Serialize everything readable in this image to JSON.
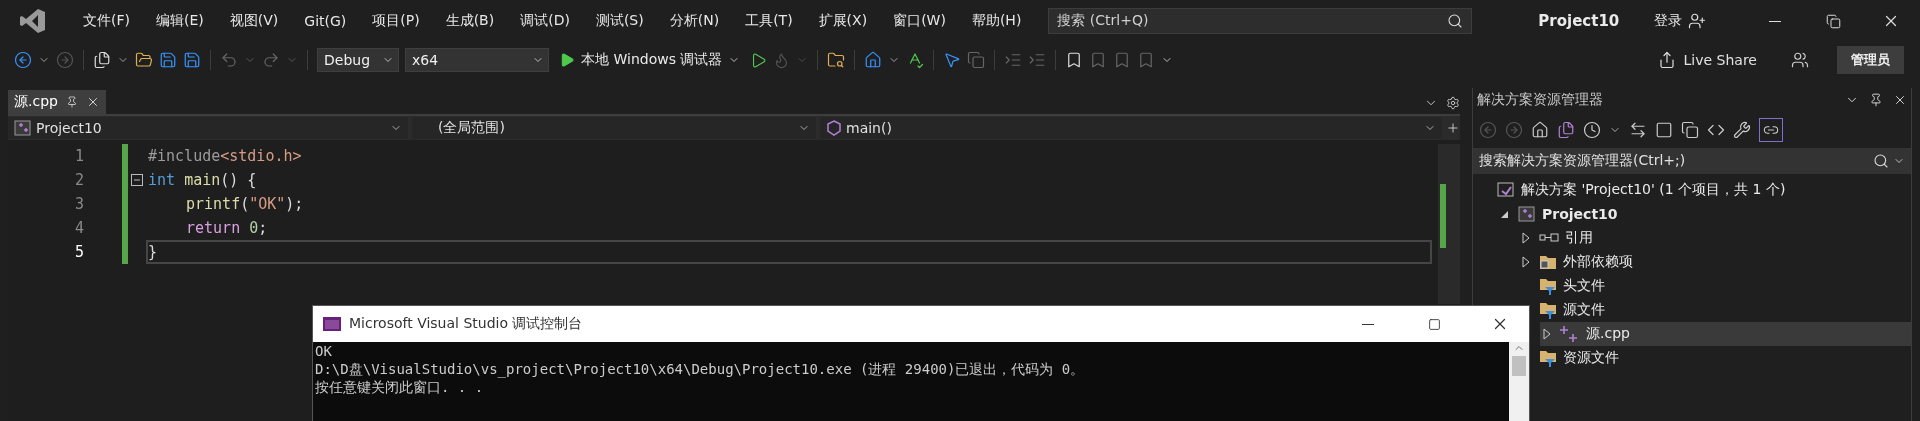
{
  "menu": [
    "文件(F)",
    "编辑(E)",
    "视图(V)",
    "Git(G)",
    "项目(P)",
    "生成(B)",
    "调试(D)",
    "测试(S)",
    "分析(N)",
    "工具(T)",
    "扩展(X)",
    "窗口(W)",
    "帮助(H)"
  ],
  "search": {
    "placeholder": "搜索 (Ctrl+Q)"
  },
  "window": {
    "title": "Project10",
    "signin": "登录"
  },
  "toolbar": {
    "configuration": "Debug",
    "platform": "x64",
    "run": "本地 Windows 调试器",
    "live_share": "Live Share",
    "admin": "管理员"
  },
  "tabs": [
    {
      "label": "源.cpp",
      "selected": true
    }
  ],
  "nav": {
    "project": "Project10",
    "scope": "(全局范围)",
    "member": "main()"
  },
  "code": [
    {
      "number": "1",
      "current": false,
      "indented": false,
      "tokens": [
        {
          "kind": "preproc",
          "text": "#include"
        },
        {
          "kind": "string",
          "text": "<stdio.h>"
        }
      ]
    },
    {
      "number": "2",
      "current": false,
      "indented": false,
      "tokens": [
        {
          "kind": "keyword",
          "text": "int "
        },
        {
          "kind": "function",
          "text": "main"
        },
        {
          "kind": "plain",
          "text": "() {"
        }
      ]
    },
    {
      "number": "3",
      "current": false,
      "indented": true,
      "tokens": [
        {
          "kind": "function",
          "text": "printf"
        },
        {
          "kind": "plain",
          "text": "("
        },
        {
          "kind": "string",
          "text": "\"OK\""
        },
        {
          "kind": "plain",
          "text": ");"
        }
      ]
    },
    {
      "number": "4",
      "current": false,
      "indented": true,
      "tokens": [
        {
          "kind": "control",
          "text": "return "
        },
        {
          "kind": "number",
          "text": "0"
        },
        {
          "kind": "plain",
          "text": ";"
        }
      ]
    },
    {
      "number": "5",
      "current": true,
      "indented": false,
      "tokens": [
        {
          "kind": "plain",
          "text": "}"
        }
      ]
    }
  ],
  "solution_explorer": {
    "title": "解决方案资源管理器",
    "search": {
      "placeholder": "搜索解决方案资源管理器(Ctrl+;)"
    },
    "tree": [
      {
        "label": "解决方案 'Project10' (1 个项目，共 1 个)",
        "kind": "solution",
        "selected": false,
        "children": [
          {
            "label": "Project10",
            "kind": "project",
            "expanded": true,
            "selected": false,
            "children": [
              {
                "label": "引用",
                "kind": "references",
                "expanded": false,
                "selected": false
              },
              {
                "label": "外部依赖项",
                "kind": "external",
                "expanded": false,
                "selected": false
              },
              {
                "label": "头文件",
                "kind": "filter",
                "selected": false
              },
              {
                "label": "源文件",
                "kind": "filter",
                "selected": false,
                "children": [
                  {
                    "label": "源.cpp",
                    "kind": "cpp",
                    "expanded": false,
                    "selected": true
                  }
                ]
              },
              {
                "label": "资源文件",
                "kind": "filter",
                "selected": false
              }
            ]
          }
        ]
      }
    ]
  },
  "console": {
    "title": "Microsoft Visual Studio 调试控制台",
    "lines": [
      "OK",
      "D:\\D盘\\VisualStudio\\vs_project\\Project10\\x64\\Debug\\Project10.exe (进程 29400)已退出，代码为 0。",
      "按任意键关闭此窗口. . ."
    ]
  }
}
